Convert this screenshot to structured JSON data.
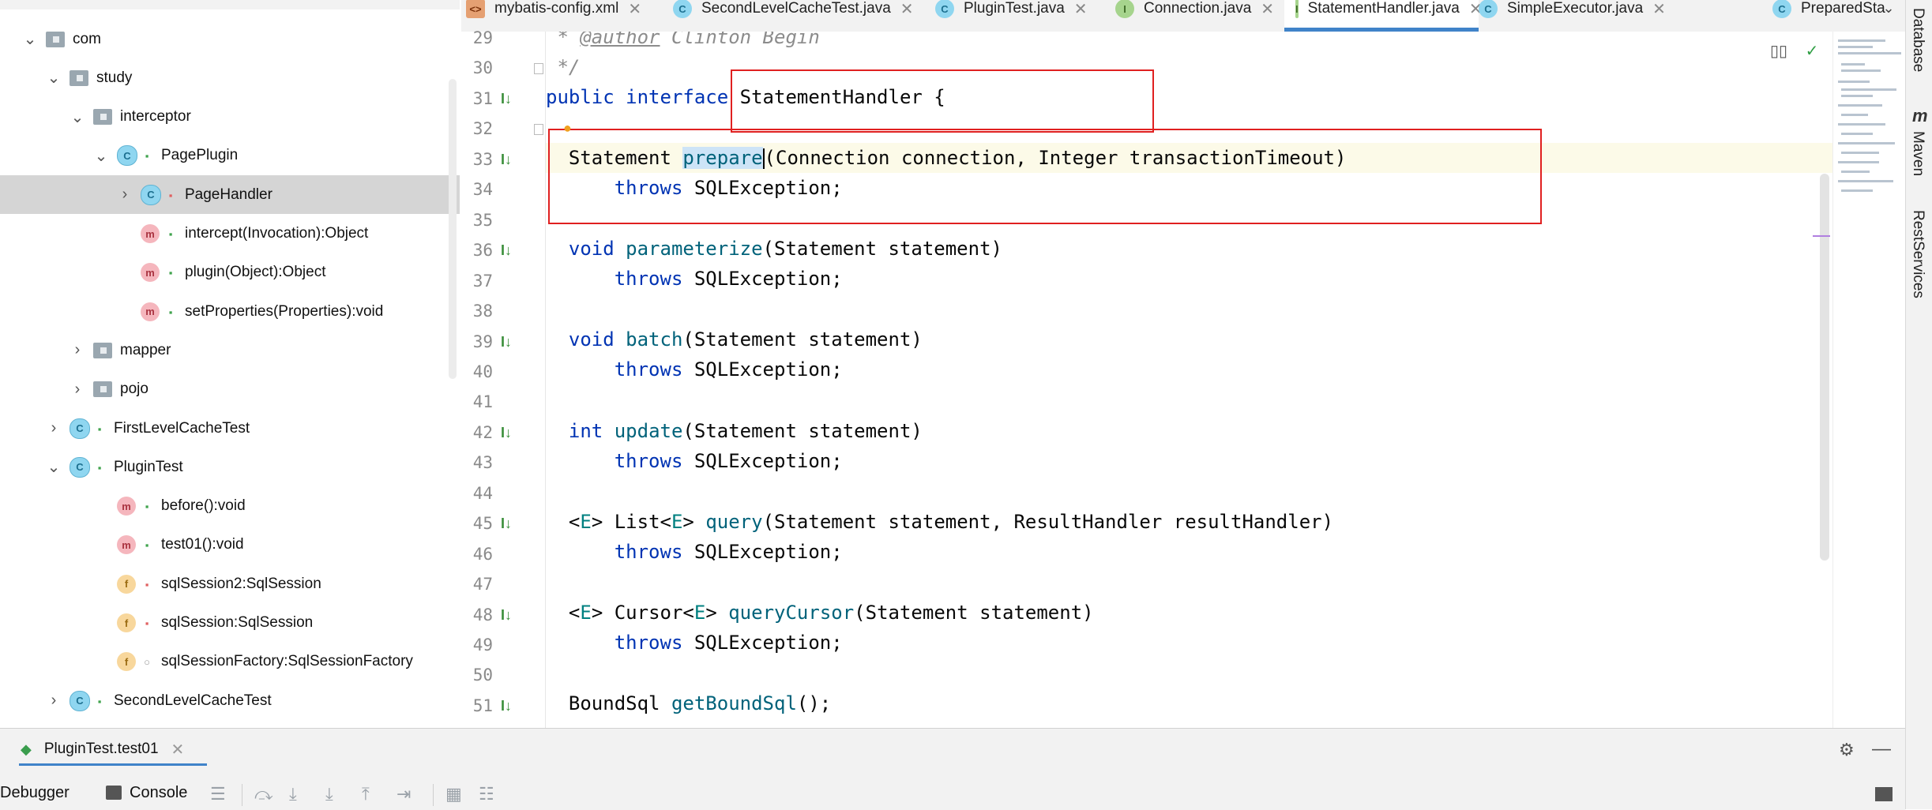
{
  "project_tree": {
    "items": [
      {
        "label": "com",
        "kind": "folder",
        "arrow": "down"
      },
      {
        "label": "study",
        "kind": "folder",
        "arrow": "down"
      },
      {
        "label": "interceptor",
        "kind": "folder",
        "arrow": "down"
      },
      {
        "label": "PagePlugin",
        "kind": "class",
        "arrow": "down",
        "lock": "open"
      },
      {
        "label": "PageHandler",
        "kind": "class",
        "arrow": "right",
        "lock": "locked",
        "selected": true
      },
      {
        "label": "intercept(Invocation):Object",
        "kind": "method",
        "lock": "open"
      },
      {
        "label": "plugin(Object):Object",
        "kind": "method",
        "lock": "open"
      },
      {
        "label": "setProperties(Properties):void",
        "kind": "method",
        "lock": "open"
      },
      {
        "label": "mapper",
        "kind": "folder",
        "arrow": "right"
      },
      {
        "label": "pojo",
        "kind": "folder",
        "arrow": "right"
      },
      {
        "label": "FirstLevelCacheTest",
        "kind": "test-class",
        "arrow": "right",
        "lock": "open"
      },
      {
        "label": "PluginTest",
        "kind": "test-class",
        "arrow": "down",
        "lock": "open"
      },
      {
        "label": "before():void",
        "kind": "method",
        "lock": "open"
      },
      {
        "label": "test01():void",
        "kind": "method",
        "lock": "open"
      },
      {
        "label": "sqlSession2:SqlSession",
        "kind": "field",
        "lock": "locked"
      },
      {
        "label": "sqlSession:SqlSession",
        "kind": "field",
        "lock": "locked"
      },
      {
        "label": "sqlSessionFactory:SqlSessionFactory",
        "kind": "field",
        "lock": "dot"
      },
      {
        "label": "SecondLevelCacheTest",
        "kind": "test-class",
        "arrow": "right",
        "lock": "open"
      }
    ]
  },
  "tabs": [
    {
      "label": "mybatis-config.xml",
      "icon": "xml-icon",
      "icon_char": "<>"
    },
    {
      "label": "SecondLevelCacheTest.java",
      "icon": "class-icon",
      "icon_char": "C"
    },
    {
      "label": "PluginTest.java",
      "icon": "class-icon",
      "icon_char": "C"
    },
    {
      "label": "Connection.java",
      "icon": "interface-icon",
      "icon_char": "I"
    },
    {
      "label": "StatementHandler.java",
      "icon": "interface-icon",
      "icon_char": "I",
      "active": true
    },
    {
      "label": "SimpleExecutor.java",
      "icon": "class-icon",
      "icon_char": "C"
    },
    {
      "label": "PreparedSta",
      "icon": "class-icon",
      "icon_char": "C"
    }
  ],
  "tab_close": "✕",
  "editor": {
    "line_numbers": [
      "29",
      "30",
      "31",
      "32",
      "33",
      "34",
      "35",
      "36",
      "37",
      "38",
      "39",
      "40",
      "41",
      "42",
      "43",
      "44",
      "45",
      "46",
      "47",
      "48",
      "49",
      "50",
      "51"
    ],
    "comment_29_star": " * ",
    "comment_29_tag": "@author",
    "comment_29_rest": " Clinton Begin",
    "comment_30": " */",
    "kw_public": "public",
    "kw_interface": "interface",
    "iface_name": " StatementHandler {",
    "l33_type": "  Statement ",
    "l33_method": "prepare",
    "l33_params": "(Connection connection, Integer transactionTimeout)",
    "kw_throws": "throws",
    "throws_ex": " SQLException;",
    "indent": "      ",
    "kw_void": "void",
    "kw_int": "int",
    "l36_method": "parameterize",
    "l36_params": "(Statement statement)",
    "l39_method": "batch",
    "l39_params": "(Statement statement)",
    "l42_method": "update",
    "l42_params": "(Statement statement)",
    "generic_open": "<",
    "generic_e": "E",
    "generic_close": ">",
    "l45_list": " List<",
    "l45_ret_close": "> ",
    "l45_method": "query",
    "l45_params": "(Statement statement, ResultHandler resultHandler)",
    "l48_cursor": " Cursor<",
    "l48_method": "queryCursor",
    "l48_params": "(Statement statement)",
    "l51_type": "  BoundSql ",
    "l51_method": "getBoundSql",
    "l51_params": "();"
  },
  "right_bar": {
    "items": [
      "Database",
      "Maven",
      "RestServices"
    ]
  },
  "bottom": {
    "run_tab": "PluginTest.test01",
    "debugger": "Debugger",
    "console": "Console"
  },
  "colors": {
    "accent": "#4083c9",
    "annotation_box": "#e02020",
    "selection": "#cde4f7"
  }
}
